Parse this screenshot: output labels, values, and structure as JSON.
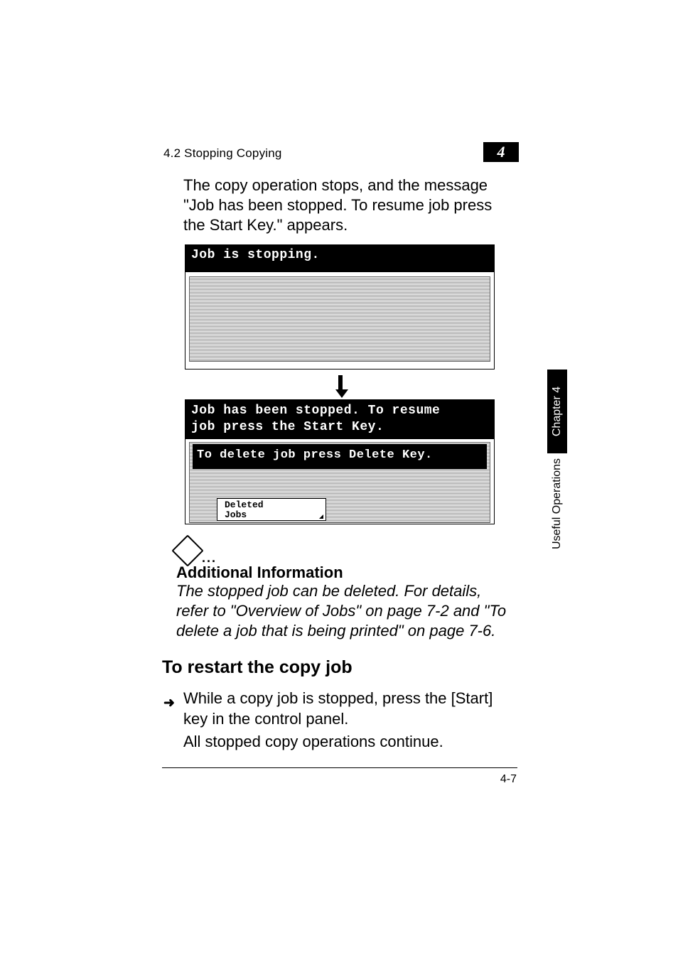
{
  "header": {
    "section_label": "4.2 Stopping Copying",
    "chapter_number": "4"
  },
  "body": {
    "para1": "The copy operation stops, and the message \"Job has been stopped. To resume job press the Start Key.\" appears."
  },
  "screenshot1": {
    "title": "Job is stopping."
  },
  "screenshot2": {
    "title_line1": "Job has been stopped. To resume",
    "title_line2": "job press the Start Key.",
    "inner_msg": "To delete job press Delete Key.",
    "button_line1": "Deleted",
    "button_line2": "Jobs"
  },
  "note": {
    "dots": "...",
    "heading": "Additional Information",
    "body": "The stopped job can be deleted. For details, refer to \"Overview of Jobs\" on page 7-2 and \"To delete a job that is being printed\" on page 7-6."
  },
  "heading2": "To restart the copy job",
  "step": {
    "arrow": "➜",
    "line1": "While a copy job is stopped, press the [Start] key in the control panel.",
    "line2": "All stopped copy operations continue."
  },
  "footer": {
    "page": "4-7"
  },
  "side": {
    "black": "Chapter 4",
    "white": "Useful Operations"
  }
}
